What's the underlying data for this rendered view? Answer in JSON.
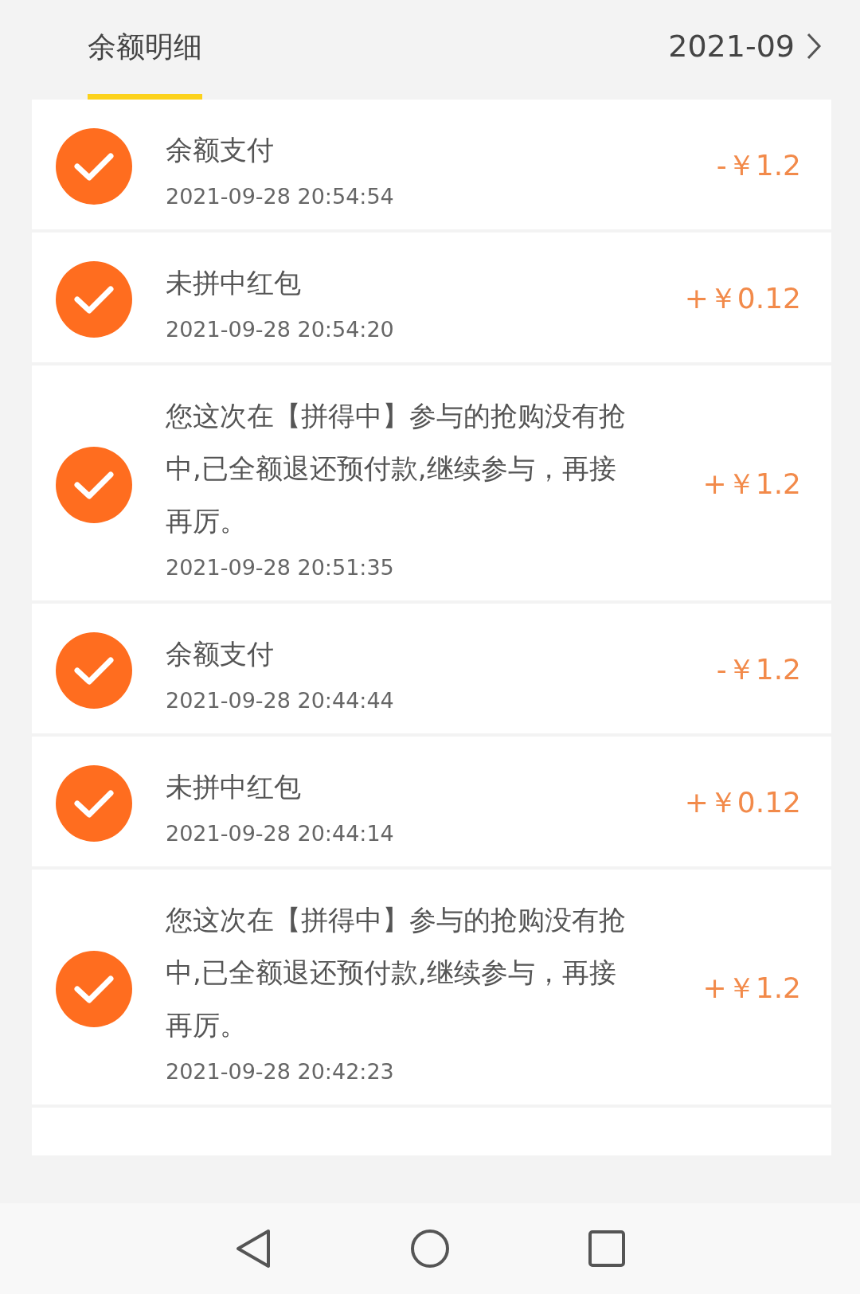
{
  "tabs": [
    {
      "label": "余额明细",
      "selected": true
    }
  ],
  "month_picker": {
    "value": "2021-09"
  },
  "records": [
    {
      "title": "余额支付",
      "time": "2021-09-28 20:54:54",
      "amount": "-￥1.2"
    },
    {
      "title": "未拼中红包",
      "time": "2021-09-28 20:54:20",
      "amount": "+￥0.12"
    },
    {
      "title": "您这次在【拼得中】参与的抢购没有抢中,已全额退还预付款,继续参与，再接再厉。",
      "time": "2021-09-28 20:51:35",
      "amount": "+￥1.2"
    },
    {
      "title": "余额支付",
      "time": "2021-09-28 20:44:44",
      "amount": "-￥1.2"
    },
    {
      "title": "未拼中红包",
      "time": "2021-09-28 20:44:14",
      "amount": "+￥0.12"
    },
    {
      "title": "您这次在【拼得中】参与的抢购没有抢中,已全额退还预付款,继续参与，再接再厉。",
      "time": "2021-09-28 20:42:23",
      "amount": "+￥1.2"
    }
  ]
}
